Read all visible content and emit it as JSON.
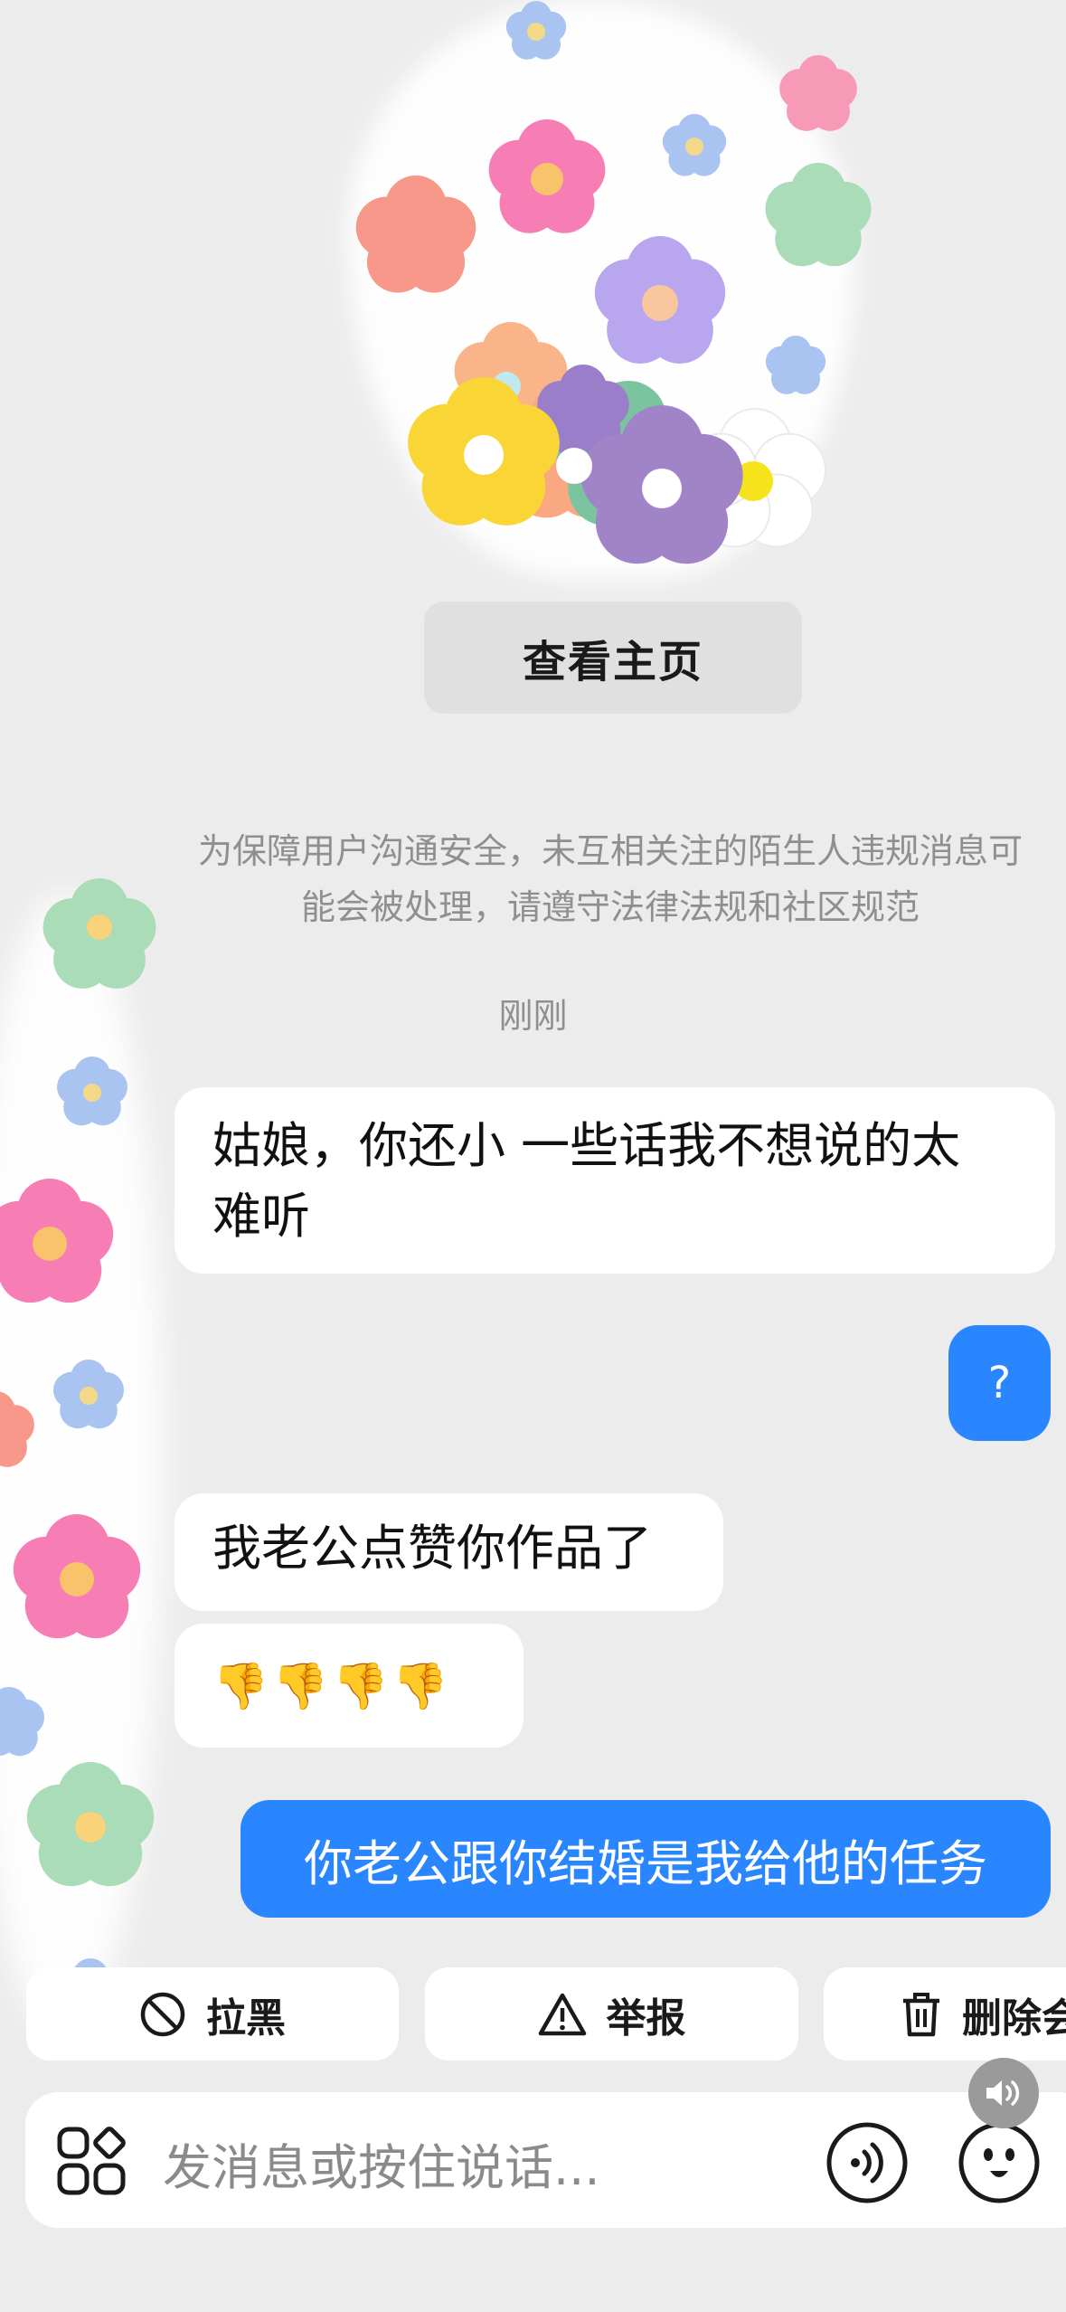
{
  "profile": {
    "view_homepage_label": "查看主页"
  },
  "notice": {
    "line1": "为保障用户沟通安全，未互相关注的陌生人违规消息可",
    "line2": "能会被处理，请遵守法律法规和社区规范"
  },
  "timestamp": "刚刚",
  "messages": [
    {
      "direction": "incoming",
      "line1": "姑娘，你还小 一些话我不想说的太",
      "line2": "难听"
    },
    {
      "direction": "outgoing",
      "text": "?"
    },
    {
      "direction": "incoming",
      "text": "我老公点赞你作品了"
    },
    {
      "direction": "incoming",
      "text": "👎👎👎👎"
    },
    {
      "direction": "outgoing",
      "text": "你老公跟你结婚是我给他的任务"
    }
  ],
  "actions": {
    "block": "拉黑",
    "report": "举报",
    "delete": "删除会"
  },
  "composer": {
    "placeholder": "发消息或按住说话..."
  },
  "colors": {
    "accent": "#2a86ff",
    "background": "#ececec",
    "bubble_incoming": "#ffffff"
  }
}
